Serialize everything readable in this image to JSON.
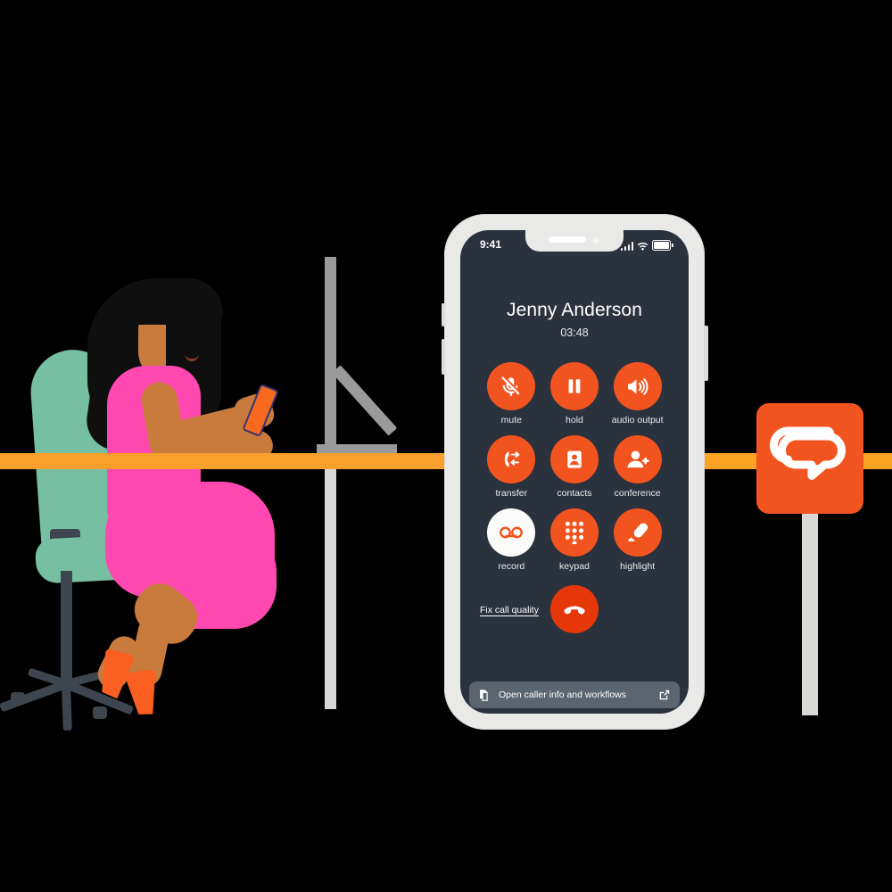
{
  "scene": {
    "description": "Illustration of a woman at a desk using a mobile phone, with a large phone mockup showing an in-call screen and an orange sign with a speech-bubble S logo",
    "colors": {
      "accent_orange": "#f2541f",
      "bar_orange": "#f8a02b",
      "screen_dark": "#2a323d",
      "end_call_red": "#e53708",
      "dress_pink": "#ff49b0",
      "chair_teal": "#77bfa3",
      "skin": "#c97b3e",
      "hair": "#100f10",
      "phone_body": "#e9e9e7",
      "bottom_bar": "#5b6570",
      "desk_gray": "#9a9a9a"
    }
  },
  "phone": {
    "status_bar": {
      "time": "9:41",
      "signal_icon": "cellular-signal-icon",
      "wifi_icon": "wifi-icon",
      "battery_icon": "battery-icon"
    },
    "call": {
      "caller_name": "Jenny Anderson",
      "duration": "03:48"
    },
    "buttons": [
      {
        "label": "mute",
        "icon": "microphone-muted-icon",
        "active": false
      },
      {
        "label": "hold",
        "icon": "pause-icon",
        "active": false
      },
      {
        "label": "audio output",
        "icon": "speaker-volume-icon",
        "active": false
      },
      {
        "label": "transfer",
        "icon": "call-transfer-icon",
        "active": false
      },
      {
        "label": "contacts",
        "icon": "contact-card-icon",
        "active": false
      },
      {
        "label": "conference",
        "icon": "add-person-icon",
        "active": false
      },
      {
        "label": "record",
        "icon": "voicemail-record-icon",
        "active": true
      },
      {
        "label": "keypad",
        "icon": "dialpad-icon",
        "active": false
      },
      {
        "label": "highlight",
        "icon": "highlighter-pen-icon",
        "active": false
      }
    ],
    "actions": {
      "fix_call_quality": "Fix call quality",
      "end_call_icon": "hang-up-phone-icon"
    },
    "bottom_bar": {
      "label": "Open caller info and workflows",
      "leading_icon": "copy-document-icon",
      "trailing_icon": "external-link-icon"
    }
  },
  "sign": {
    "logo_icon": "speech-bubble-s-logo"
  }
}
